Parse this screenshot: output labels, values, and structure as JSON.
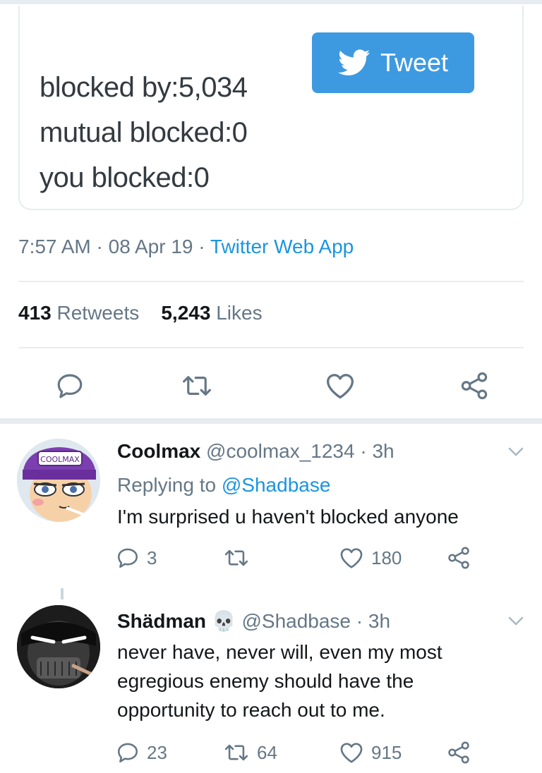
{
  "card": {
    "blocked_by": "blocked by:5,034",
    "mutual_blocked": "mutual blocked:0",
    "you_blocked": "you blocked:0",
    "tweet_button_label": "Tweet"
  },
  "tweet_meta": {
    "time": "7:57 AM",
    "sep1": " · ",
    "date": "08 Apr 19",
    "sep2": " · ",
    "app": "Twitter Web App"
  },
  "stats": {
    "retweets_count": "413",
    "retweets_label": "Retweets",
    "likes_count": "5,243",
    "likes_label": "Likes"
  },
  "actions": [
    "reply-icon",
    "retweet-icon",
    "like-icon",
    "share-icon"
  ],
  "replies": [
    {
      "name": "Coolmax",
      "handle": "@coolmax_1234 · 3h",
      "replying_prefix": "Replying to ",
      "replying_handle": "@Shadbase",
      "text": "I'm surprised u haven't blocked anyone",
      "reply_count": "3",
      "retweet_count": "",
      "like_count": "180",
      "avatar_cap_text": "COOLMAX"
    },
    {
      "name": "Shädman",
      "handle": "@Shadbase · 3h",
      "text_line1": "never have, never will, even my most",
      "text_line2": "egregious enemy should have the",
      "text_line3": "opportunity to reach out to me.",
      "reply_count": "23",
      "retweet_count": "64",
      "like_count": "915"
    }
  ],
  "colors": {
    "link": "#1b95e0",
    "muted": "#657786",
    "tweet_button": "#3d9ae0",
    "divider": "#e6ecf0"
  }
}
